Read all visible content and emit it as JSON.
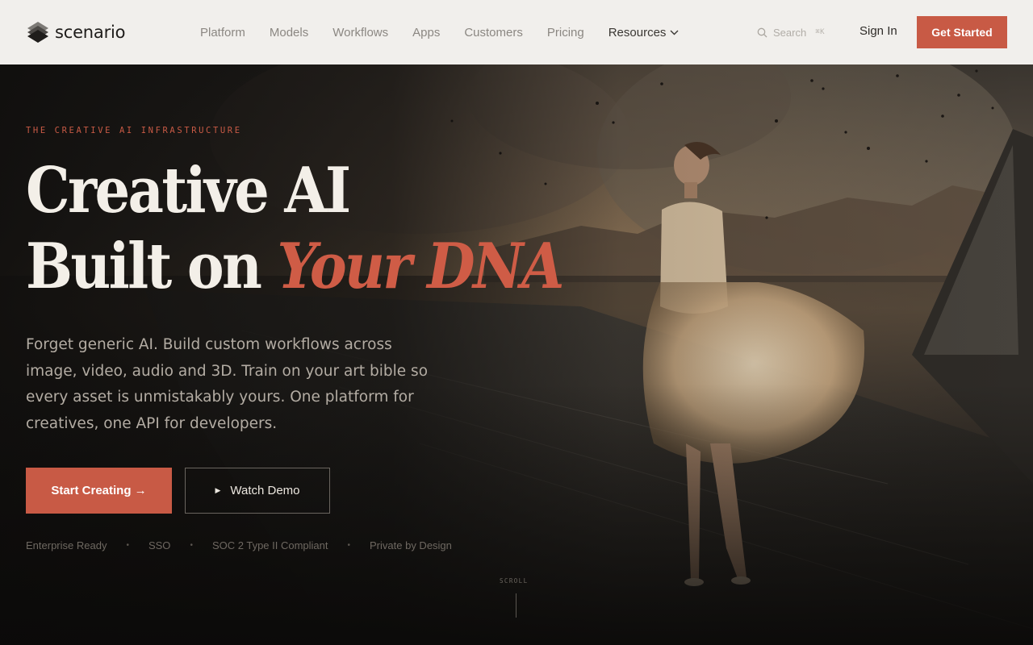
{
  "nav": {
    "logo_text": "scenario",
    "menu": [
      "Platform",
      "Models",
      "Workflows",
      "Apps",
      "Customers",
      "Pricing",
      "Resources"
    ],
    "search": {
      "placeholder": "Search",
      "shortcut": "⌘K"
    },
    "sign_in": "Sign In",
    "cta": "Get Started"
  },
  "hero": {
    "eyebrow": "THE CREATIVE AI INFRASTRUCTURE",
    "headline_line1": "Creative AI",
    "headline_line2_prefix": "Built on ",
    "headline_line2_accent": "Your DNA",
    "subcopy": "Forget generic AI. Build custom workflows across image, video, audio and 3D. Train on your art bible so every asset is unmistakably yours. One platform for creatives, one API for developers.",
    "primary_cta": "Start Creating →",
    "secondary_cta": "Watch Demo",
    "badges": [
      "Enterprise Ready",
      "SSO",
      "SOC 2 Type II Compliant",
      "Private by Design"
    ],
    "scroll_label": "SCROLL"
  },
  "colors": {
    "accent": "#c85a45",
    "nav_bg": "#f1efec",
    "hero_text": "#f3efe8"
  },
  "icons": [
    "logo-icon",
    "chevron-down-icon",
    "search-icon",
    "play-icon",
    "arrow-right-icon"
  ]
}
